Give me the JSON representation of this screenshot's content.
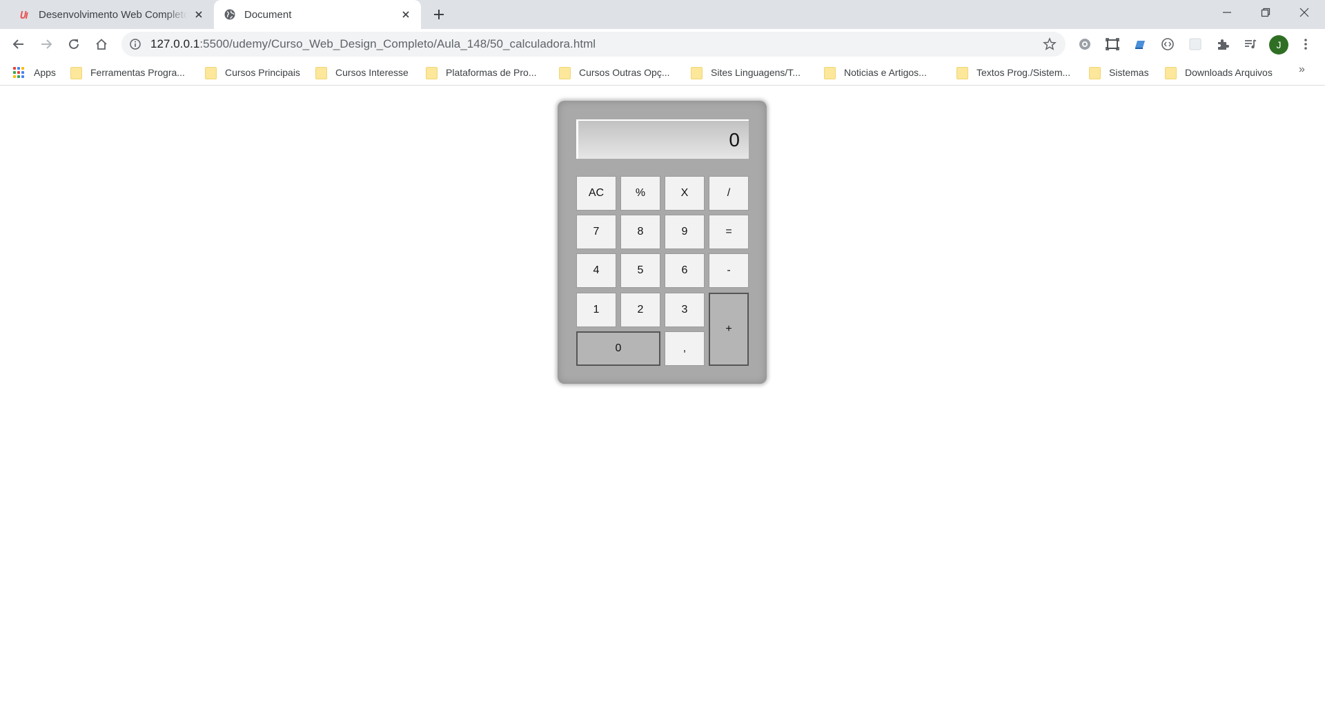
{
  "browser": {
    "tabs": [
      {
        "title": "Desenvolvimento Web Completo",
        "favicon": "udemy-icon",
        "active": false
      },
      {
        "title": "Document",
        "favicon": "globe-icon",
        "active": true
      }
    ],
    "address": {
      "host": "127.0.0.1",
      "path": ":5500/udemy/Curso_Web_Design_Completo/Aula_148/50_calculadora.html"
    },
    "avatar_initial": "J",
    "avatar_color": "#2f6f24",
    "bookmarks": [
      {
        "label": "Apps",
        "icon": "apps-grid-icon"
      },
      {
        "label": "Ferramentas Progra...",
        "icon": "folder-icon"
      },
      {
        "label": "Cursos Principais",
        "icon": "folder-icon"
      },
      {
        "label": "Cursos Interesse",
        "icon": "folder-icon"
      },
      {
        "label": "Plataformas de Pro...",
        "icon": "folder-icon"
      },
      {
        "label": "Cursos Outras Opç...",
        "icon": "folder-icon"
      },
      {
        "label": "Sites Linguagens/T...",
        "icon": "folder-icon"
      },
      {
        "label": "Noticias e Artigos...",
        "icon": "folder-icon"
      },
      {
        "label": "Textos Prog./Sistem...",
        "icon": "folder-icon"
      },
      {
        "label": "Sistemas",
        "icon": "folder-icon"
      },
      {
        "label": "Downloads Arquivos",
        "icon": "folder-icon"
      }
    ],
    "bookmarks_overflow": "»"
  },
  "calculator": {
    "display": "0",
    "keys": {
      "ac": "AC",
      "percent": "%",
      "multiply": "X",
      "divide": "/",
      "seven": "7",
      "eight": "8",
      "nine": "9",
      "equals": "=",
      "four": "4",
      "five": "5",
      "six": "6",
      "minus": "-",
      "one": "1",
      "two": "2",
      "three": "3",
      "plus": "+",
      "zero": "0",
      "comma": ","
    },
    "colors": {
      "body": "#a9a9a9",
      "key": "#f2f2f2",
      "key_dark": "#b5b5b5"
    }
  }
}
